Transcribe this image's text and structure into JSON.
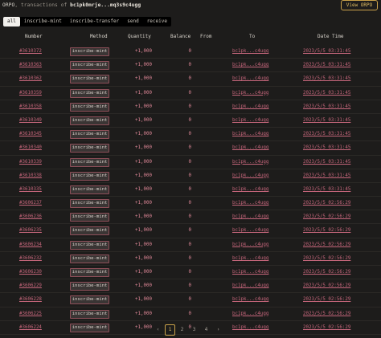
{
  "header": {
    "tick": "ORPO",
    "middle": ", transactions of ",
    "address": "bc1pk0mrje...mq3s9c4ugg"
  },
  "view_button": "View ORPO",
  "tabs": [
    "all",
    "inscribe-mint",
    "inscribe-transfer",
    "send",
    "receive"
  ],
  "columns": [
    "Number",
    "Method",
    "Quantity",
    "Balance",
    "From",
    "To",
    "Date Time"
  ],
  "rows": [
    {
      "number": "#3610372",
      "method": "inscribe-mint",
      "quantity": "+1,000",
      "balance": "0",
      "from": "",
      "to": "bc1pk...c4ugg",
      "datetime": "2023/5/5 03:31:45"
    },
    {
      "number": "#3610363",
      "method": "inscribe-mint",
      "quantity": "+1,000",
      "balance": "0",
      "from": "",
      "to": "bc1pk...c4ugg",
      "datetime": "2023/5/5 03:31:45"
    },
    {
      "number": "#3610362",
      "method": "inscribe-mint",
      "quantity": "+1,000",
      "balance": "0",
      "from": "",
      "to": "bc1pk...c4ugg",
      "datetime": "2023/5/5 03:31:45"
    },
    {
      "number": "#3610359",
      "method": "inscribe-mint",
      "quantity": "+1,000",
      "balance": "0",
      "from": "",
      "to": "bc1pk...c4ugg",
      "datetime": "2023/5/5 03:31:45"
    },
    {
      "number": "#3610358",
      "method": "inscribe-mint",
      "quantity": "+1,000",
      "balance": "0",
      "from": "",
      "to": "bc1pk...c4ugg",
      "datetime": "2023/5/5 03:31:45"
    },
    {
      "number": "#3610349",
      "method": "inscribe-mint",
      "quantity": "+1,000",
      "balance": "0",
      "from": "",
      "to": "bc1pk...c4ugg",
      "datetime": "2023/5/5 03:31:45"
    },
    {
      "number": "#3610345",
      "method": "inscribe-mint",
      "quantity": "+1,000",
      "balance": "0",
      "from": "",
      "to": "bc1pk...c4ugg",
      "datetime": "2023/5/5 03:31:45"
    },
    {
      "number": "#3610340",
      "method": "inscribe-mint",
      "quantity": "+1,000",
      "balance": "0",
      "from": "",
      "to": "bc1pk...c4ugg",
      "datetime": "2023/5/5 03:31:45"
    },
    {
      "number": "#3610339",
      "method": "inscribe-mint",
      "quantity": "+1,000",
      "balance": "0",
      "from": "",
      "to": "bc1pk...c4ugg",
      "datetime": "2023/5/5 03:31:45"
    },
    {
      "number": "#3610338",
      "method": "inscribe-mint",
      "quantity": "+1,000",
      "balance": "0",
      "from": "",
      "to": "bc1pk...c4ugg",
      "datetime": "2023/5/5 03:31:45"
    },
    {
      "number": "#3610335",
      "method": "inscribe-mint",
      "quantity": "+1,000",
      "balance": "0",
      "from": "",
      "to": "bc1pk...c4ugg",
      "datetime": "2023/5/5 03:31:45"
    },
    {
      "number": "#3606237",
      "method": "inscribe-mint",
      "quantity": "+1,000",
      "balance": "0",
      "from": "",
      "to": "bc1pk...c4ugg",
      "datetime": "2023/5/5 02:56:29"
    },
    {
      "number": "#3606236",
      "method": "inscribe-mint",
      "quantity": "+1,000",
      "balance": "0",
      "from": "",
      "to": "bc1pk...c4ugg",
      "datetime": "2023/5/5 02:56:29"
    },
    {
      "number": "#3606235",
      "method": "inscribe-mint",
      "quantity": "+1,000",
      "balance": "0",
      "from": "",
      "to": "bc1pk...c4ugg",
      "datetime": "2023/5/5 02:56:29"
    },
    {
      "number": "#3606234",
      "method": "inscribe-mint",
      "quantity": "+1,000",
      "balance": "0",
      "from": "",
      "to": "bc1pk...c4ugg",
      "datetime": "2023/5/5 02:56:29"
    },
    {
      "number": "#3606232",
      "method": "inscribe-mint",
      "quantity": "+1,000",
      "balance": "0",
      "from": "",
      "to": "bc1pk...c4ugg",
      "datetime": "2023/5/5 02:56:29"
    },
    {
      "number": "#3606230",
      "method": "inscribe-mint",
      "quantity": "+1,000",
      "balance": "0",
      "from": "",
      "to": "bc1pk...c4ugg",
      "datetime": "2023/5/5 02:56:29"
    },
    {
      "number": "#3606229",
      "method": "inscribe-mint",
      "quantity": "+1,000",
      "balance": "0",
      "from": "",
      "to": "bc1pk...c4ugg",
      "datetime": "2023/5/5 02:56:29"
    },
    {
      "number": "#3606228",
      "method": "inscribe-mint",
      "quantity": "+1,000",
      "balance": "0",
      "from": "",
      "to": "bc1pk...c4ugg",
      "datetime": "2023/5/5 02:56:29"
    },
    {
      "number": "#3606225",
      "method": "inscribe-mint",
      "quantity": "+1,000",
      "balance": "0",
      "from": "",
      "to": "bc1pk...c4ugg",
      "datetime": "2023/5/5 02:56:29"
    },
    {
      "number": "#3606224",
      "method": "inscribe-mint",
      "quantity": "+1,000",
      "balance": "0",
      "from": "",
      "to": "bc1pk...c4ugg",
      "datetime": "2023/5/5 02:56:29"
    }
  ],
  "pagination": {
    "prev": "‹",
    "pages": [
      "1",
      "2",
      "3",
      "4"
    ],
    "next": "›",
    "current_page": 1
  },
  "colors": {
    "background": "#1d1c1b",
    "accent_gold": "#caa24a",
    "link_pink": "#c5667b",
    "method_badge_border": "#8e4f59"
  }
}
